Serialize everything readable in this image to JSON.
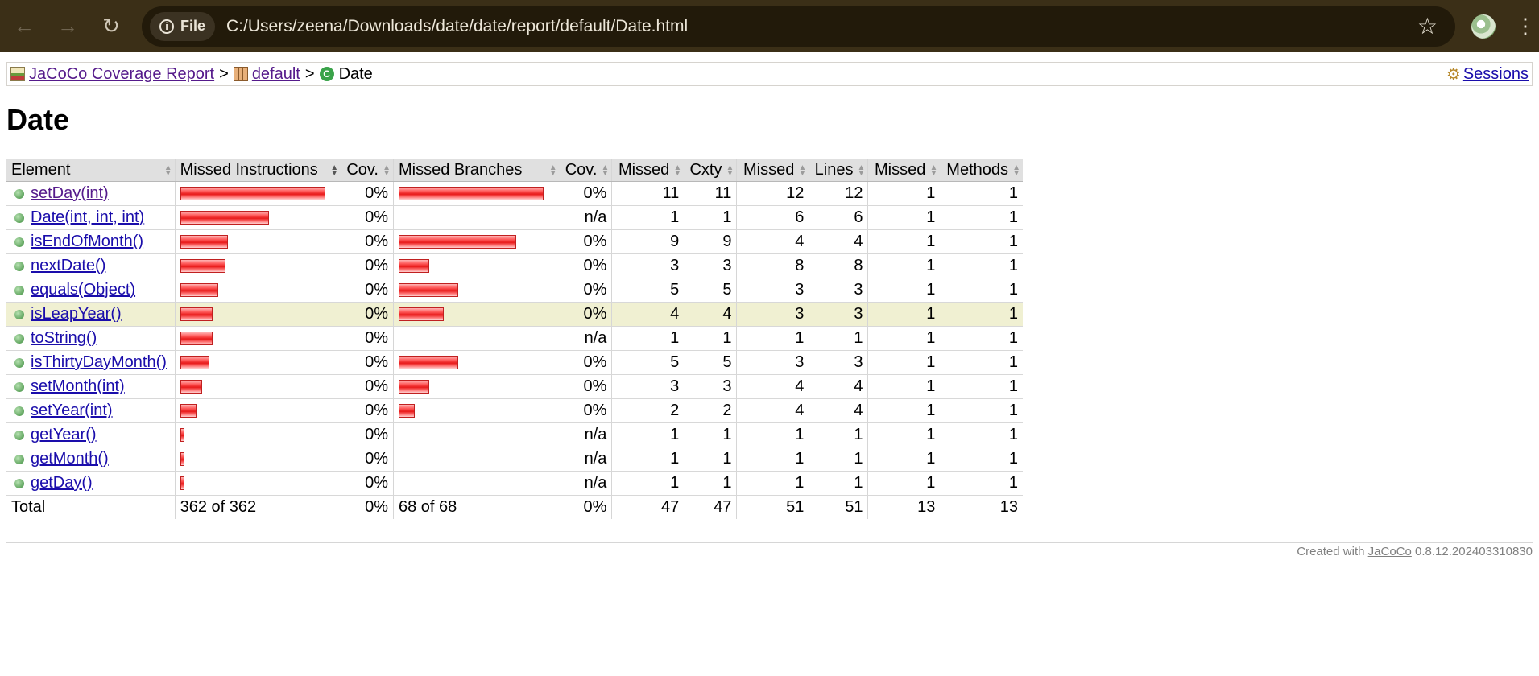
{
  "browser": {
    "url": "C:/Users/zeena/Downloads/date/date/report/default/Date.html",
    "file_chip": "File",
    "back_icon": "arrow-left-icon",
    "forward_icon": "arrow-right-icon",
    "reload_icon": "reload-icon",
    "star_icon": "star-icon",
    "menu_icon": "kebab-menu-icon"
  },
  "breadcrumb": {
    "report_label": "JaCoCo Coverage Report",
    "package_label": "default",
    "class_label": "Date",
    "separator": ">",
    "sessions_label": "Sessions"
  },
  "page": {
    "title": "Date"
  },
  "table": {
    "headers": {
      "element": "Element",
      "missed_instructions": "Missed Instructions",
      "cov1": "Cov.",
      "missed_branches": "Missed Branches",
      "cov2": "Cov.",
      "missed_cxty": "Missed",
      "cxty": "Cxty",
      "missed_lines": "Missed",
      "lines": "Lines",
      "missed_methods": "Missed",
      "methods": "Methods"
    },
    "rows": [
      {
        "name": "setDay(int)",
        "instr_bar": 1.0,
        "instr_cov": "0%",
        "branch_bar": 1.0,
        "branch_cov": "0%",
        "missed_cxty": "11",
        "cxty": "11",
        "missed_lines": "12",
        "lines": "12",
        "missed_methods": "1",
        "methods": "1"
      },
      {
        "name": "Date(int, int, int)",
        "instr_bar": 0.61,
        "instr_cov": "0%",
        "branch_bar": 0,
        "branch_cov": "n/a",
        "missed_cxty": "1",
        "cxty": "1",
        "missed_lines": "6",
        "lines": "6",
        "missed_methods": "1",
        "methods": "1"
      },
      {
        "name": "isEndOfMonth()",
        "instr_bar": 0.33,
        "instr_cov": "0%",
        "branch_bar": 0.81,
        "branch_cov": "0%",
        "missed_cxty": "9",
        "cxty": "9",
        "missed_lines": "4",
        "lines": "4",
        "missed_methods": "1",
        "methods": "1"
      },
      {
        "name": "nextDate()",
        "instr_bar": 0.31,
        "instr_cov": "0%",
        "branch_bar": 0.21,
        "branch_cov": "0%",
        "missed_cxty": "3",
        "cxty": "3",
        "missed_lines": "8",
        "lines": "8",
        "missed_methods": "1",
        "methods": "1"
      },
      {
        "name": "equals(Object)",
        "instr_bar": 0.26,
        "instr_cov": "0%",
        "branch_bar": 0.41,
        "branch_cov": "0%",
        "missed_cxty": "5",
        "cxty": "5",
        "missed_lines": "3",
        "lines": "3",
        "missed_methods": "1",
        "methods": "1"
      },
      {
        "name": "isLeapYear()",
        "instr_bar": 0.22,
        "instr_cov": "0%",
        "branch_bar": 0.31,
        "branch_cov": "0%",
        "missed_cxty": "4",
        "cxty": "4",
        "missed_lines": "3",
        "lines": "3",
        "missed_methods": "1",
        "methods": "1",
        "highlight": true
      },
      {
        "name": "toString()",
        "instr_bar": 0.22,
        "instr_cov": "0%",
        "branch_bar": 0,
        "branch_cov": "n/a",
        "missed_cxty": "1",
        "cxty": "1",
        "missed_lines": "1",
        "lines": "1",
        "missed_methods": "1",
        "methods": "1"
      },
      {
        "name": "isThirtyDayMonth()",
        "instr_bar": 0.2,
        "instr_cov": "0%",
        "branch_bar": 0.41,
        "branch_cov": "0%",
        "missed_cxty": "5",
        "cxty": "5",
        "missed_lines": "3",
        "lines": "3",
        "missed_methods": "1",
        "methods": "1"
      },
      {
        "name": "setMonth(int)",
        "instr_bar": 0.15,
        "instr_cov": "0%",
        "branch_bar": 0.21,
        "branch_cov": "0%",
        "missed_cxty": "3",
        "cxty": "3",
        "missed_lines": "4",
        "lines": "4",
        "missed_methods": "1",
        "methods": "1"
      },
      {
        "name": "setYear(int)",
        "instr_bar": 0.11,
        "instr_cov": "0%",
        "branch_bar": 0.11,
        "branch_cov": "0%",
        "missed_cxty": "2",
        "cxty": "2",
        "missed_lines": "4",
        "lines": "4",
        "missed_methods": "1",
        "methods": "1"
      },
      {
        "name": "getYear()",
        "instr_bar": 0.03,
        "instr_cov": "0%",
        "branch_bar": 0,
        "branch_cov": "n/a",
        "missed_cxty": "1",
        "cxty": "1",
        "missed_lines": "1",
        "lines": "1",
        "missed_methods": "1",
        "methods": "1"
      },
      {
        "name": "getMonth()",
        "instr_bar": 0.03,
        "instr_cov": "0%",
        "branch_bar": 0,
        "branch_cov": "n/a",
        "missed_cxty": "1",
        "cxty": "1",
        "missed_lines": "1",
        "lines": "1",
        "missed_methods": "1",
        "methods": "1"
      },
      {
        "name": "getDay()",
        "instr_bar": 0.03,
        "instr_cov": "0%",
        "branch_bar": 0,
        "branch_cov": "n/a",
        "missed_cxty": "1",
        "cxty": "1",
        "missed_lines": "1",
        "lines": "1",
        "missed_methods": "1",
        "methods": "1"
      }
    ],
    "total": {
      "label": "Total",
      "instr": "362 of 362",
      "instr_cov": "0%",
      "branch": "68 of 68",
      "branch_cov": "0%",
      "missed_cxty": "47",
      "cxty": "47",
      "missed_lines": "51",
      "lines": "51",
      "missed_methods": "13",
      "methods": "13"
    }
  },
  "footer": {
    "prefix": "Created with",
    "link": "JaCoCo",
    "version": "0.8.12.202403310830"
  },
  "colors": {
    "chrome_bg": "#3b2f17",
    "bar_red": "#e81a1a",
    "highlight_row": "#f0f0d2",
    "header_bg": "#e0e0e0"
  }
}
